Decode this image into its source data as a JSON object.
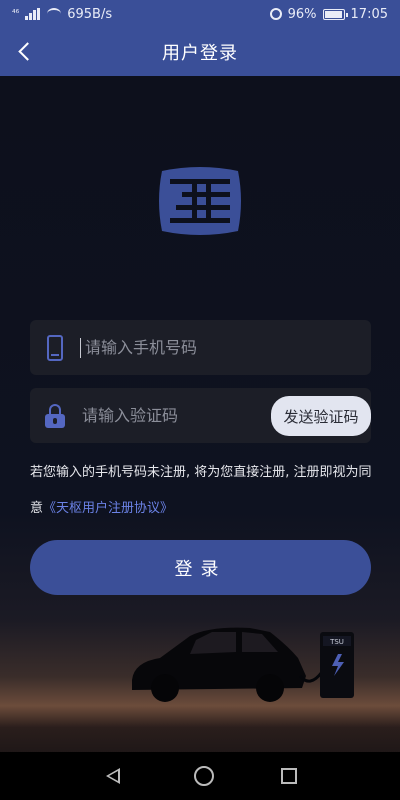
{
  "status_bar": {
    "network_label": "⁴⁶",
    "speed": "695B/s",
    "battery": "96%",
    "time": "17:05"
  },
  "nav": {
    "title": "用户登录"
  },
  "form": {
    "phone_placeholder": "请输入手机号码",
    "code_placeholder": "请输入验证码",
    "send_code_label": "发送验证码",
    "login_label": "登录"
  },
  "terms": {
    "text": "若您输入的手机号码未注册, 将为您直接注册, 注册即视为同意",
    "link": "《天枢用户注册协议》"
  },
  "charger_label": "TSU",
  "colors": {
    "accent": "#3b4f98",
    "link": "#6b82e6",
    "field_bg": "#1c1e27"
  },
  "icons": [
    "back-arrow-icon",
    "phone-icon",
    "lock-icon",
    "app-logo"
  ]
}
